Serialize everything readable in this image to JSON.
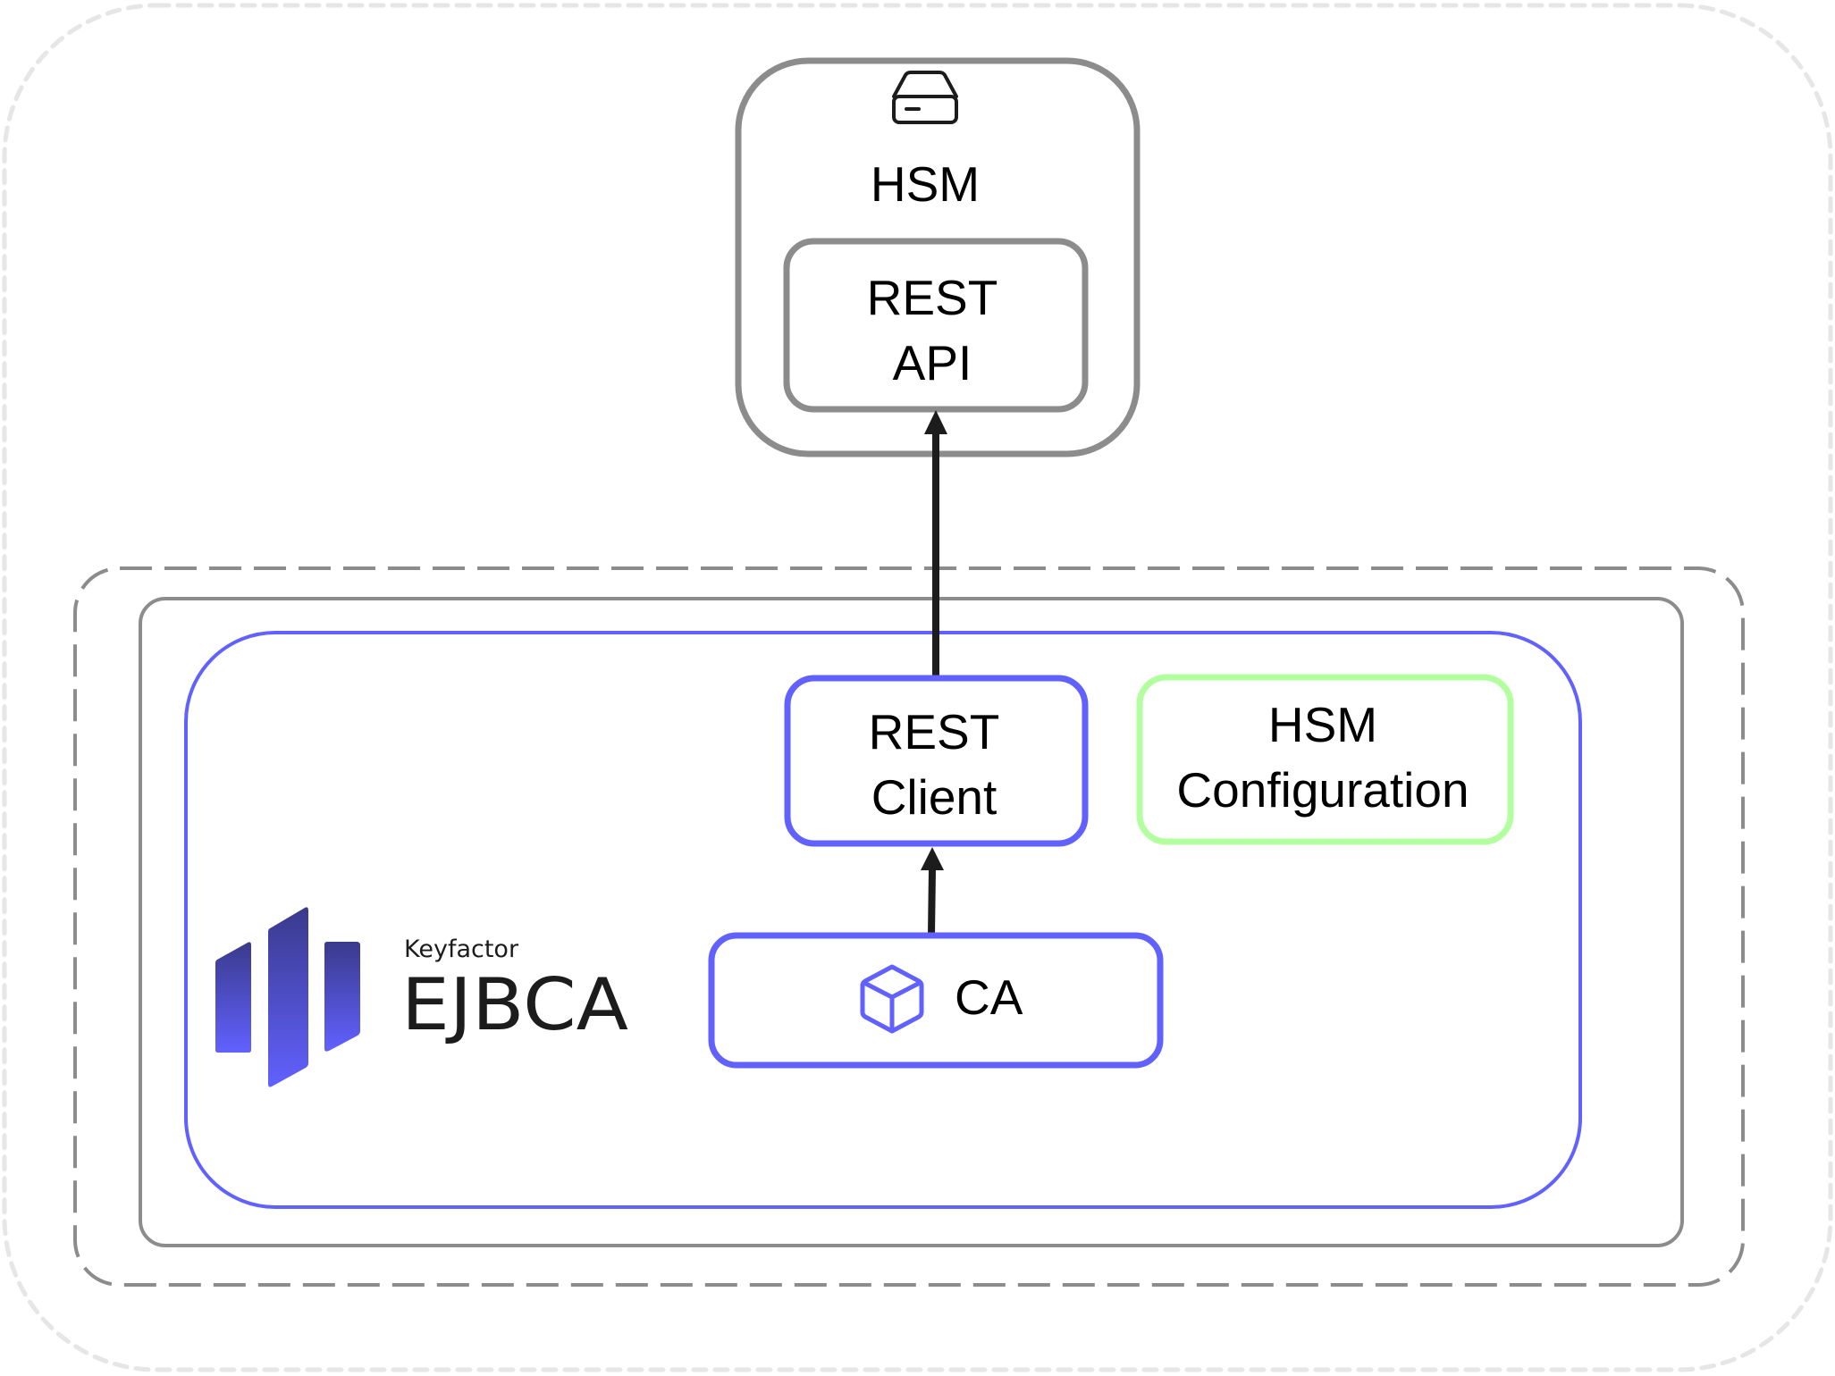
{
  "diagram": {
    "canvas": {
      "outer_frame_style": "light-dashed"
    },
    "colors": {
      "frame_gray": "#8c8c8c",
      "outer_faint": "#e6e6e6",
      "ejbca_blue": "#6161ff",
      "config_green": "#b3ffa0",
      "arrow": "#1c1c1c",
      "logo_dark": "#3a3a8c",
      "logo_light": "#6161ff"
    },
    "hsm": {
      "icon": "hsm-device-icon",
      "title": "HSM",
      "rest_api": {
        "line1": "REST",
        "line2": "API"
      }
    },
    "ejbca": {
      "brand": {
        "company": "Keyfactor",
        "product": "EJBCA",
        "logo": "keyfactor-bars-logo"
      },
      "rest_client": {
        "line1": "REST",
        "line2": "Client"
      },
      "hsm_configuration": {
        "line1": "HSM",
        "line2": "Configuration"
      },
      "ca": {
        "icon": "cube-icon",
        "label": "CA"
      }
    },
    "connections": [
      {
        "from": "CA",
        "to": "REST Client",
        "style": "arrow"
      },
      {
        "from": "REST Client",
        "to": "REST API",
        "style": "arrow"
      }
    ]
  }
}
